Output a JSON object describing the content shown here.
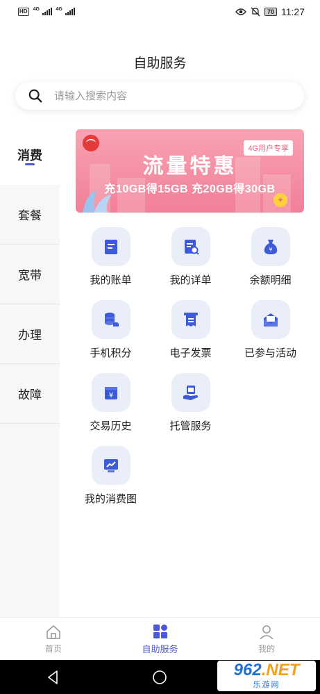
{
  "status_bar": {
    "time": "11:27",
    "battery": "70",
    "hd": "HD",
    "net_a": "4G",
    "net_b": "4G"
  },
  "header": {
    "title": "自助服务"
  },
  "search": {
    "placeholder": "请输入搜索内容"
  },
  "sidebar": {
    "items": [
      {
        "label": "消费",
        "active": true
      },
      {
        "label": "套餐"
      },
      {
        "label": "宽带"
      },
      {
        "label": "办理"
      },
      {
        "label": "故障"
      }
    ]
  },
  "banner": {
    "tag": "4G用户专享",
    "title": "流量特惠",
    "subtitle": "充10GB得15GB 充20GB得30GB"
  },
  "services": [
    {
      "label": "我的账单",
      "icon": "bill-icon"
    },
    {
      "label": "我的详单",
      "icon": "detail-list-icon"
    },
    {
      "label": "余额明细",
      "icon": "money-bag-icon"
    },
    {
      "label": "手机积分",
      "icon": "coins-icon"
    },
    {
      "label": "电子发票",
      "icon": "invoice-icon"
    },
    {
      "label": "已参与活动",
      "icon": "mail-icon"
    },
    {
      "label": "交易历史",
      "icon": "yuan-wallet-icon"
    },
    {
      "label": "托管服务",
      "icon": "hosting-icon"
    },
    {
      "label": "我的消费图",
      "icon": "chart-icon"
    }
  ],
  "bottom_nav": {
    "tabs": [
      {
        "label": "首页",
        "icon": "home-icon"
      },
      {
        "label": "自助服务",
        "icon": "grid-icon",
        "active": true
      },
      {
        "label": "我的",
        "icon": "user-icon"
      }
    ]
  },
  "watermark": {
    "main_a": "962",
    "main_b": ".NET",
    "sub": "乐游网"
  },
  "colors": {
    "accent": "#4a5bd8",
    "icon_bg": "#e9eef9",
    "banner": "#f27f97"
  }
}
